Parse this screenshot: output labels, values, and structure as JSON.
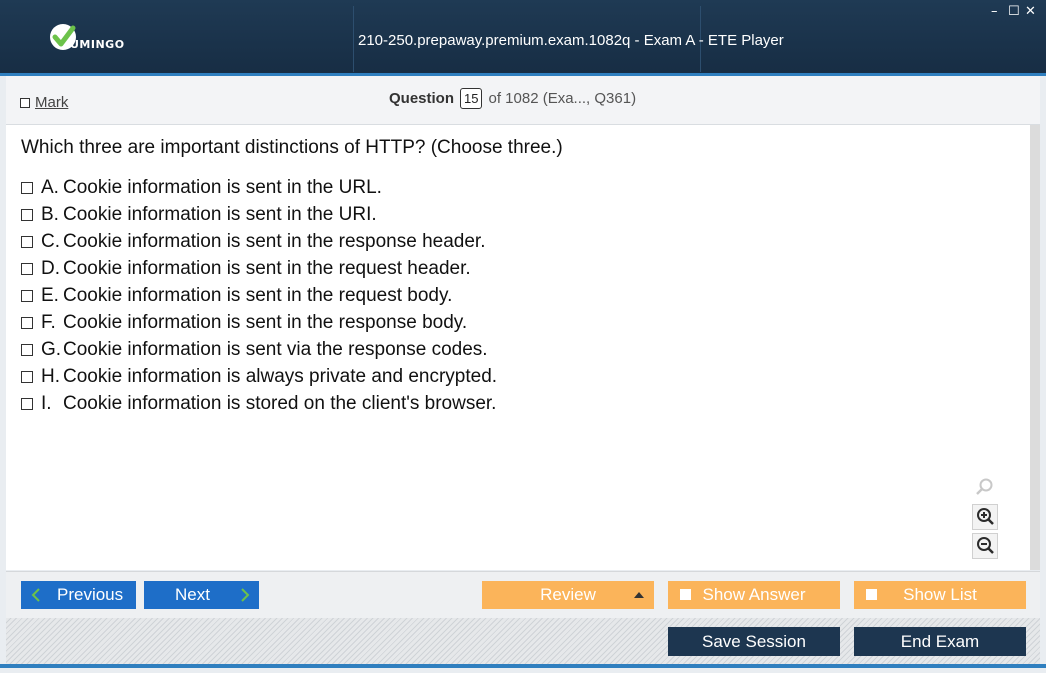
{
  "app": {
    "title": "210-250.prepaway.premium.exam.1082q - Exam A - ETE Player",
    "logo_text": "UMINGO",
    "brand_color": "#1f3a54",
    "accent_color": "#2f7fbf"
  },
  "window_controls": {
    "minimize": "–",
    "maximize": "☐",
    "close": "✕"
  },
  "header": {
    "mark_label": "Mark",
    "question_label": "Question",
    "question_number": "15",
    "question_total": "of 1082 (Exa..., Q361)"
  },
  "question": {
    "text": "Which three are important distinctions of HTTP? (Choose three.)",
    "options": [
      {
        "letter": "A.",
        "text": "Cookie information is sent in the URL."
      },
      {
        "letter": "B.",
        "text": "Cookie information is sent in the URI."
      },
      {
        "letter": "C.",
        "text": "Cookie information is sent in the response header."
      },
      {
        "letter": "D.",
        "text": "Cookie information is sent in the request header."
      },
      {
        "letter": "E.",
        "text": "Cookie information is sent in the request body."
      },
      {
        "letter": "F.",
        "text": "Cookie information is sent in the response body."
      },
      {
        "letter": "G.",
        "text": "Cookie information is sent via the response codes."
      },
      {
        "letter": "H.",
        "text": "Cookie information is always private and encrypted."
      },
      {
        "letter": "I.",
        "text": "Cookie information is stored on the client's browser."
      }
    ]
  },
  "zoom": {
    "icons": [
      "search-icon",
      "zoom-in-icon",
      "zoom-out-icon"
    ]
  },
  "nav": {
    "previous_label": "Previous",
    "next_label": "Next",
    "review_label": "Review",
    "show_answer_label": "Show Answer",
    "show_list_label": "Show List",
    "nav_color": "#1e6ec8",
    "option_color": "#fbb45a"
  },
  "footer": {
    "save_session_label": "Save Session",
    "end_exam_label": "End Exam",
    "footer_color": "#1d3650"
  }
}
